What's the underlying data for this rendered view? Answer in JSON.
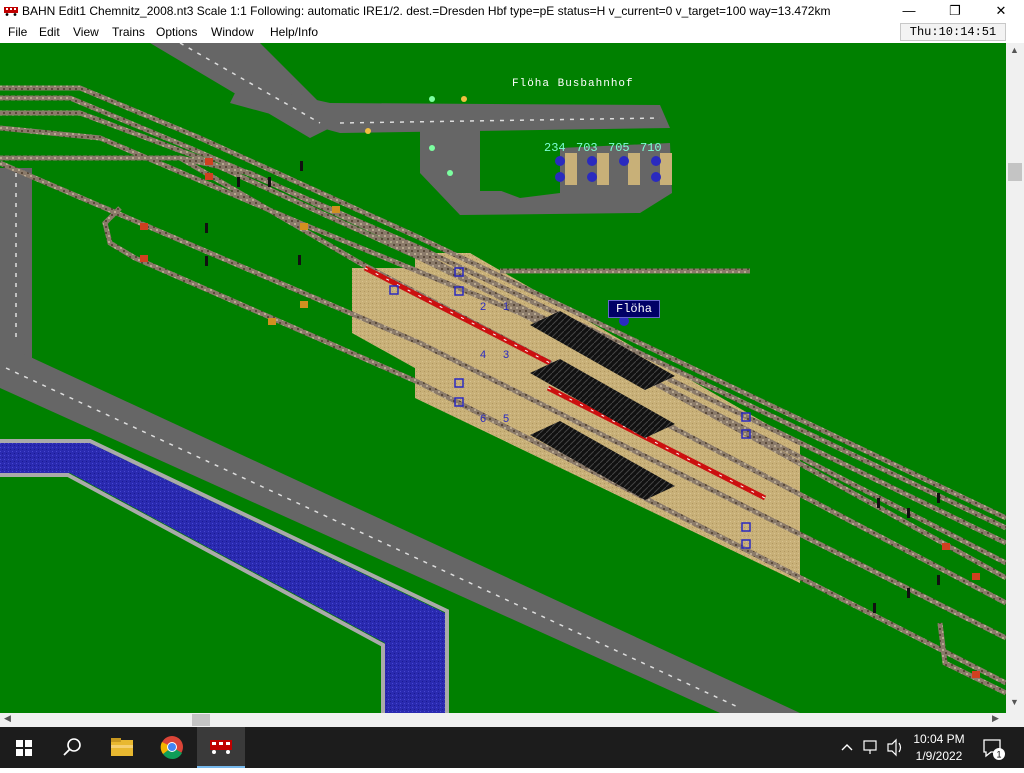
{
  "window": {
    "title": "BAHN Edit1 Chemnitz_2008.nt3 Scale 1:1 Following: automatic IRE1/2.  dest.=Dresden Hbf type=pE status=H  v_current=0 v_target=100 way=13.472km",
    "minimize_label": "—",
    "maximize_label": "❐",
    "close_label": "✕"
  },
  "menu": {
    "items": [
      "File",
      "Edit",
      "View",
      "Trains",
      "Options",
      "Window",
      "Help/Info"
    ],
    "clock": "Thu:10:14:51"
  },
  "map": {
    "bus_station_label": "Flöha Busbahnhof",
    "station_label": "Flöha",
    "bus_stops": [
      "234",
      "703",
      "705",
      "710"
    ],
    "track_numbers": [
      "2",
      "1",
      "4",
      "3",
      "6",
      "5"
    ],
    "colors": {
      "grass": "#008000",
      "road": "#666666",
      "water": "#2a2ab0",
      "platform": "#c8b078",
      "roof": "#101010",
      "train": "#cc1010"
    }
  },
  "taskbar": {
    "time": "10:04 PM",
    "date": "1/9/2022",
    "notification_count": "1",
    "icons": [
      "windows-start-icon",
      "search-icon",
      "file-explorer-icon",
      "chrome-icon",
      "bahn-app-icon"
    ]
  }
}
